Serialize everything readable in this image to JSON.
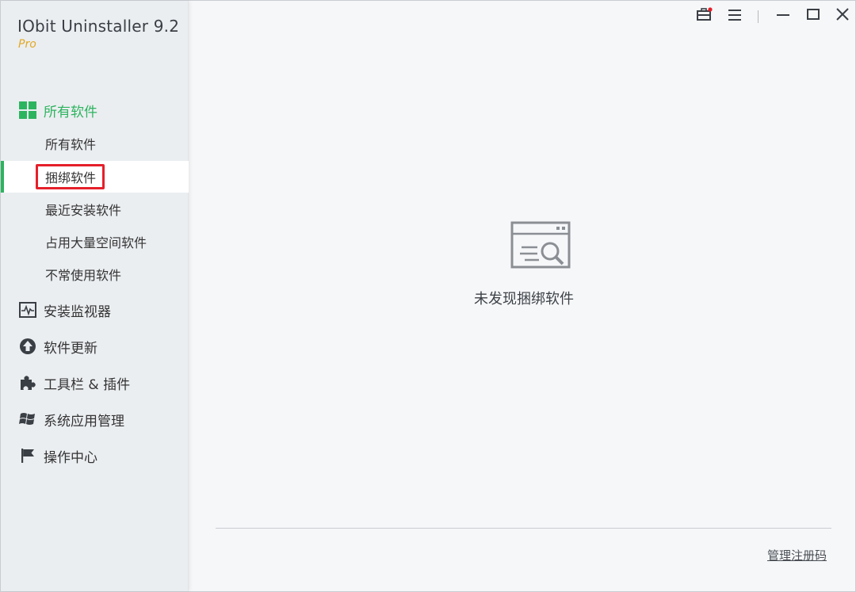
{
  "app": {
    "title": "IObit Uninstaller 9.2",
    "edition": "Pro"
  },
  "sidebar": {
    "groups": [
      {
        "label": "所有软件",
        "icon": "grid-icon",
        "active": true,
        "items": [
          {
            "label": "所有软件",
            "selected": false
          },
          {
            "label": "捆绑软件",
            "selected": true,
            "highlighted": true
          },
          {
            "label": "最近安装软件",
            "selected": false
          },
          {
            "label": "占用大量空间软件",
            "selected": false
          },
          {
            "label": "不常使用软件",
            "selected": false
          }
        ]
      },
      {
        "label": "安装监视器",
        "icon": "monitor-pulse-icon"
      },
      {
        "label": "软件更新",
        "icon": "upload-arrow-icon"
      },
      {
        "label": "工具栏 & 插件",
        "icon": "puzzle-icon"
      },
      {
        "label": "系统应用管理",
        "icon": "windows-logo-icon"
      },
      {
        "label": "操作中心",
        "icon": "flag-icon"
      }
    ]
  },
  "titlebar": {
    "buttons": [
      "toolbox-icon",
      "menu-icon",
      "minimize-icon",
      "maximize-icon",
      "close-icon"
    ]
  },
  "main": {
    "empty_message": "未发现捆绑软件",
    "empty_icon": "window-search-icon"
  },
  "footer": {
    "manage_license": "管理注册码"
  },
  "colors": {
    "accent": "#2db45f",
    "edition": "#e2a823",
    "highlight_box": "#e5202a"
  }
}
